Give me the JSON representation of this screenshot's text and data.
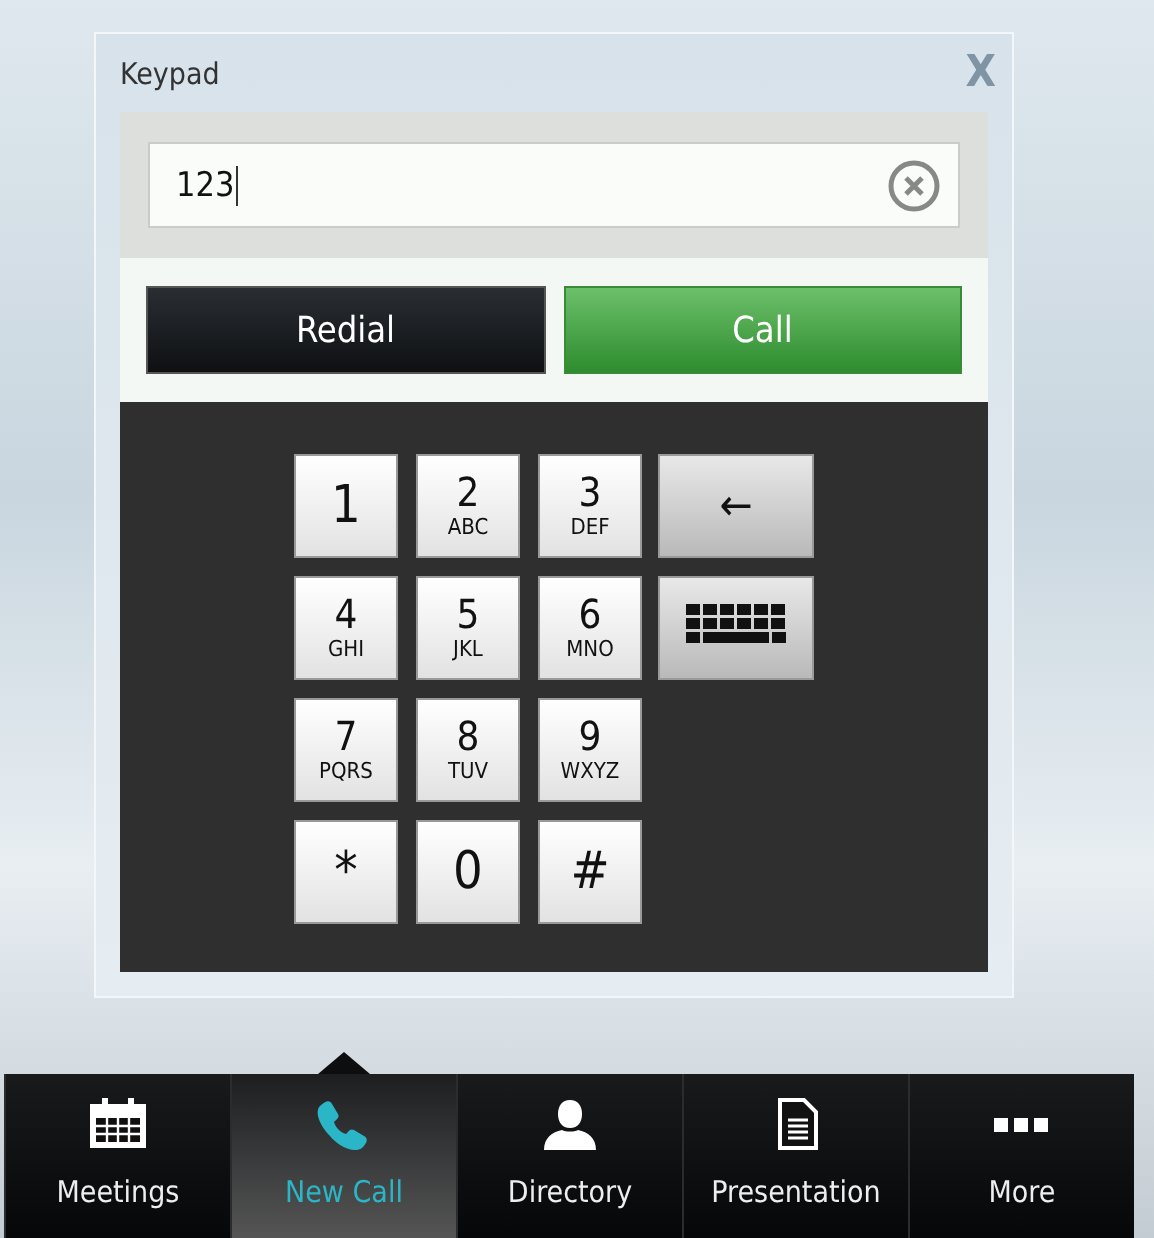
{
  "dialog": {
    "title": "Keypad",
    "close": "X",
    "field": {
      "value": "123"
    },
    "buttons": [
      {
        "kind": "redial",
        "label": "Redial"
      },
      {
        "kind": "call",
        "label": "Call"
      }
    ],
    "keys": [
      {
        "digit": "1"
      },
      {
        "digit": "2",
        "letters": "ABC"
      },
      {
        "digit": "3",
        "letters": "DEF"
      },
      {
        "digit": "4",
        "letters": "GHI"
      },
      {
        "digit": "5",
        "letters": "JKL"
      },
      {
        "digit": "6",
        "letters": "MNO"
      },
      {
        "digit": "7",
        "letters": "PQRS"
      },
      {
        "digit": "8",
        "letters": "TUV"
      },
      {
        "digit": "9",
        "letters": "WXYZ"
      },
      {
        "digit": "*"
      },
      {
        "digit": "0"
      },
      {
        "digit": "#"
      }
    ],
    "side_keys": [
      {
        "kind": "backspace",
        "label": "←"
      },
      {
        "kind": "keyboard"
      }
    ]
  },
  "nav": [
    {
      "label": "Meetings",
      "selected": false
    },
    {
      "label": "New Call",
      "selected": true
    },
    {
      "label": "Directory",
      "selected": false
    },
    {
      "label": "Presentation",
      "selected": false
    },
    {
      "label": "More",
      "selected": false
    }
  ]
}
